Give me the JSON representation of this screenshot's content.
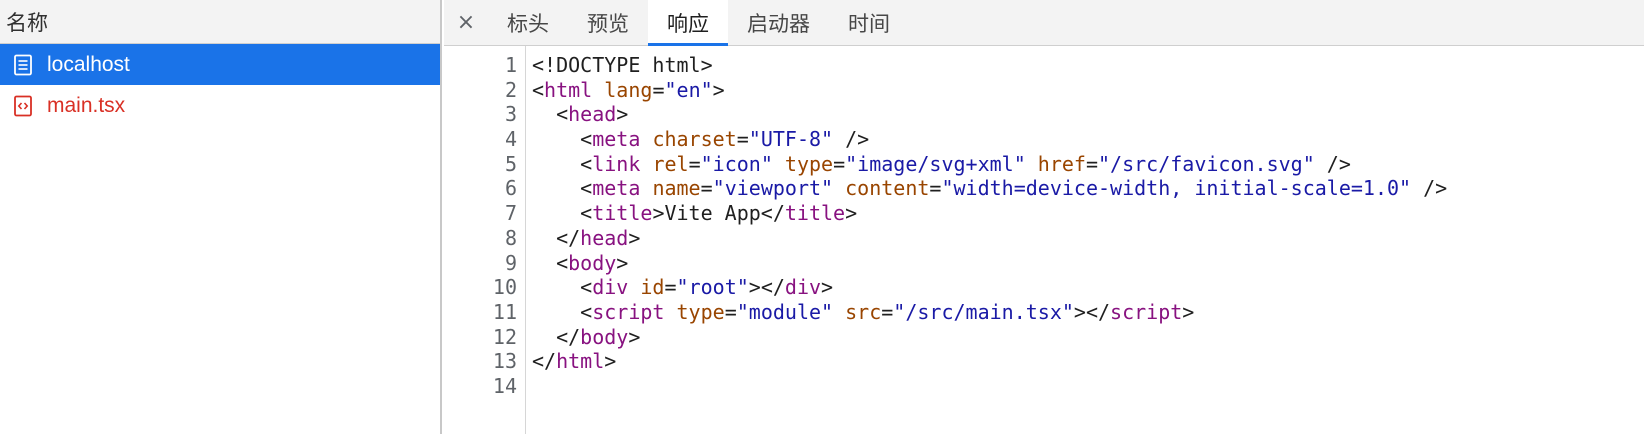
{
  "left": {
    "header": "名称",
    "requests": [
      {
        "name": "localhost",
        "icon": "document-icon",
        "state": "selected"
      },
      {
        "name": "main.tsx",
        "icon": "script-icon",
        "state": "error"
      }
    ]
  },
  "right": {
    "close": "×",
    "tabs": [
      {
        "label": "标头",
        "active": false
      },
      {
        "label": "预览",
        "active": false
      },
      {
        "label": "响应",
        "active": true
      },
      {
        "label": "启动器",
        "active": false
      },
      {
        "label": "时间",
        "active": false
      }
    ],
    "line_numbers": [
      "1",
      "2",
      "3",
      "4",
      "5",
      "6",
      "7",
      "8",
      "9",
      "10",
      "11",
      "12",
      "13",
      "14"
    ],
    "code_lines": [
      [
        {
          "t": "p",
          "v": "<!DOCTYPE html>"
        }
      ],
      [
        {
          "t": "p",
          "v": "<"
        },
        {
          "t": "tag",
          "v": "html"
        },
        {
          "t": "p",
          "v": " "
        },
        {
          "t": "attr",
          "v": "lang"
        },
        {
          "t": "p",
          "v": "="
        },
        {
          "t": "val",
          "v": "\"en\""
        },
        {
          "t": "p",
          "v": ">"
        }
      ],
      [
        {
          "t": "p",
          "v": "  <"
        },
        {
          "t": "tag",
          "v": "head"
        },
        {
          "t": "p",
          "v": ">"
        }
      ],
      [
        {
          "t": "p",
          "v": "    <"
        },
        {
          "t": "tag",
          "v": "meta"
        },
        {
          "t": "p",
          "v": " "
        },
        {
          "t": "attr",
          "v": "charset"
        },
        {
          "t": "p",
          "v": "="
        },
        {
          "t": "val",
          "v": "\"UTF-8\""
        },
        {
          "t": "p",
          "v": " />"
        }
      ],
      [
        {
          "t": "p",
          "v": "    <"
        },
        {
          "t": "tag",
          "v": "link"
        },
        {
          "t": "p",
          "v": " "
        },
        {
          "t": "attr",
          "v": "rel"
        },
        {
          "t": "p",
          "v": "="
        },
        {
          "t": "val",
          "v": "\"icon\""
        },
        {
          "t": "p",
          "v": " "
        },
        {
          "t": "attr",
          "v": "type"
        },
        {
          "t": "p",
          "v": "="
        },
        {
          "t": "val",
          "v": "\"image/svg+xml\""
        },
        {
          "t": "p",
          "v": " "
        },
        {
          "t": "attr",
          "v": "href"
        },
        {
          "t": "p",
          "v": "="
        },
        {
          "t": "val",
          "v": "\"/src/favicon.svg\""
        },
        {
          "t": "p",
          "v": " />"
        }
      ],
      [
        {
          "t": "p",
          "v": "    <"
        },
        {
          "t": "tag",
          "v": "meta"
        },
        {
          "t": "p",
          "v": " "
        },
        {
          "t": "attr",
          "v": "name"
        },
        {
          "t": "p",
          "v": "="
        },
        {
          "t": "val",
          "v": "\"viewport\""
        },
        {
          "t": "p",
          "v": " "
        },
        {
          "t": "attr",
          "v": "content"
        },
        {
          "t": "p",
          "v": "="
        },
        {
          "t": "val",
          "v": "\"width=device-width, initial-scale=1.0\""
        },
        {
          "t": "p",
          "v": " />"
        }
      ],
      [
        {
          "t": "p",
          "v": "    <"
        },
        {
          "t": "tag",
          "v": "title"
        },
        {
          "t": "p",
          "v": ">Vite App</"
        },
        {
          "t": "tag",
          "v": "title"
        },
        {
          "t": "p",
          "v": ">"
        }
      ],
      [
        {
          "t": "p",
          "v": "  </"
        },
        {
          "t": "tag",
          "v": "head"
        },
        {
          "t": "p",
          "v": ">"
        }
      ],
      [
        {
          "t": "p",
          "v": "  <"
        },
        {
          "t": "tag",
          "v": "body"
        },
        {
          "t": "p",
          "v": ">"
        }
      ],
      [
        {
          "t": "p",
          "v": "    <"
        },
        {
          "t": "tag",
          "v": "div"
        },
        {
          "t": "p",
          "v": " "
        },
        {
          "t": "attr",
          "v": "id"
        },
        {
          "t": "p",
          "v": "="
        },
        {
          "t": "val",
          "v": "\"root\""
        },
        {
          "t": "p",
          "v": "></"
        },
        {
          "t": "tag",
          "v": "div"
        },
        {
          "t": "p",
          "v": ">"
        }
      ],
      [
        {
          "t": "p",
          "v": "    <"
        },
        {
          "t": "tag",
          "v": "script"
        },
        {
          "t": "p",
          "v": " "
        },
        {
          "t": "attr",
          "v": "type"
        },
        {
          "t": "p",
          "v": "="
        },
        {
          "t": "val",
          "v": "\"module\""
        },
        {
          "t": "p",
          "v": " "
        },
        {
          "t": "attr",
          "v": "src"
        },
        {
          "t": "p",
          "v": "="
        },
        {
          "t": "val",
          "v": "\"/src/main.tsx\""
        },
        {
          "t": "p",
          "v": "></"
        },
        {
          "t": "tag",
          "v": "script"
        },
        {
          "t": "p",
          "v": ">"
        }
      ],
      [
        {
          "t": "p",
          "v": "  </"
        },
        {
          "t": "tag",
          "v": "body"
        },
        {
          "t": "p",
          "v": ">"
        }
      ],
      [
        {
          "t": "p",
          "v": "</"
        },
        {
          "t": "tag",
          "v": "html"
        },
        {
          "t": "p",
          "v": ">"
        }
      ],
      []
    ]
  },
  "colors": {
    "selected_bg": "#1a73e8",
    "error_text": "#d93025",
    "tag": "#881280",
    "attr": "#994500",
    "value": "#1a1aa6"
  }
}
